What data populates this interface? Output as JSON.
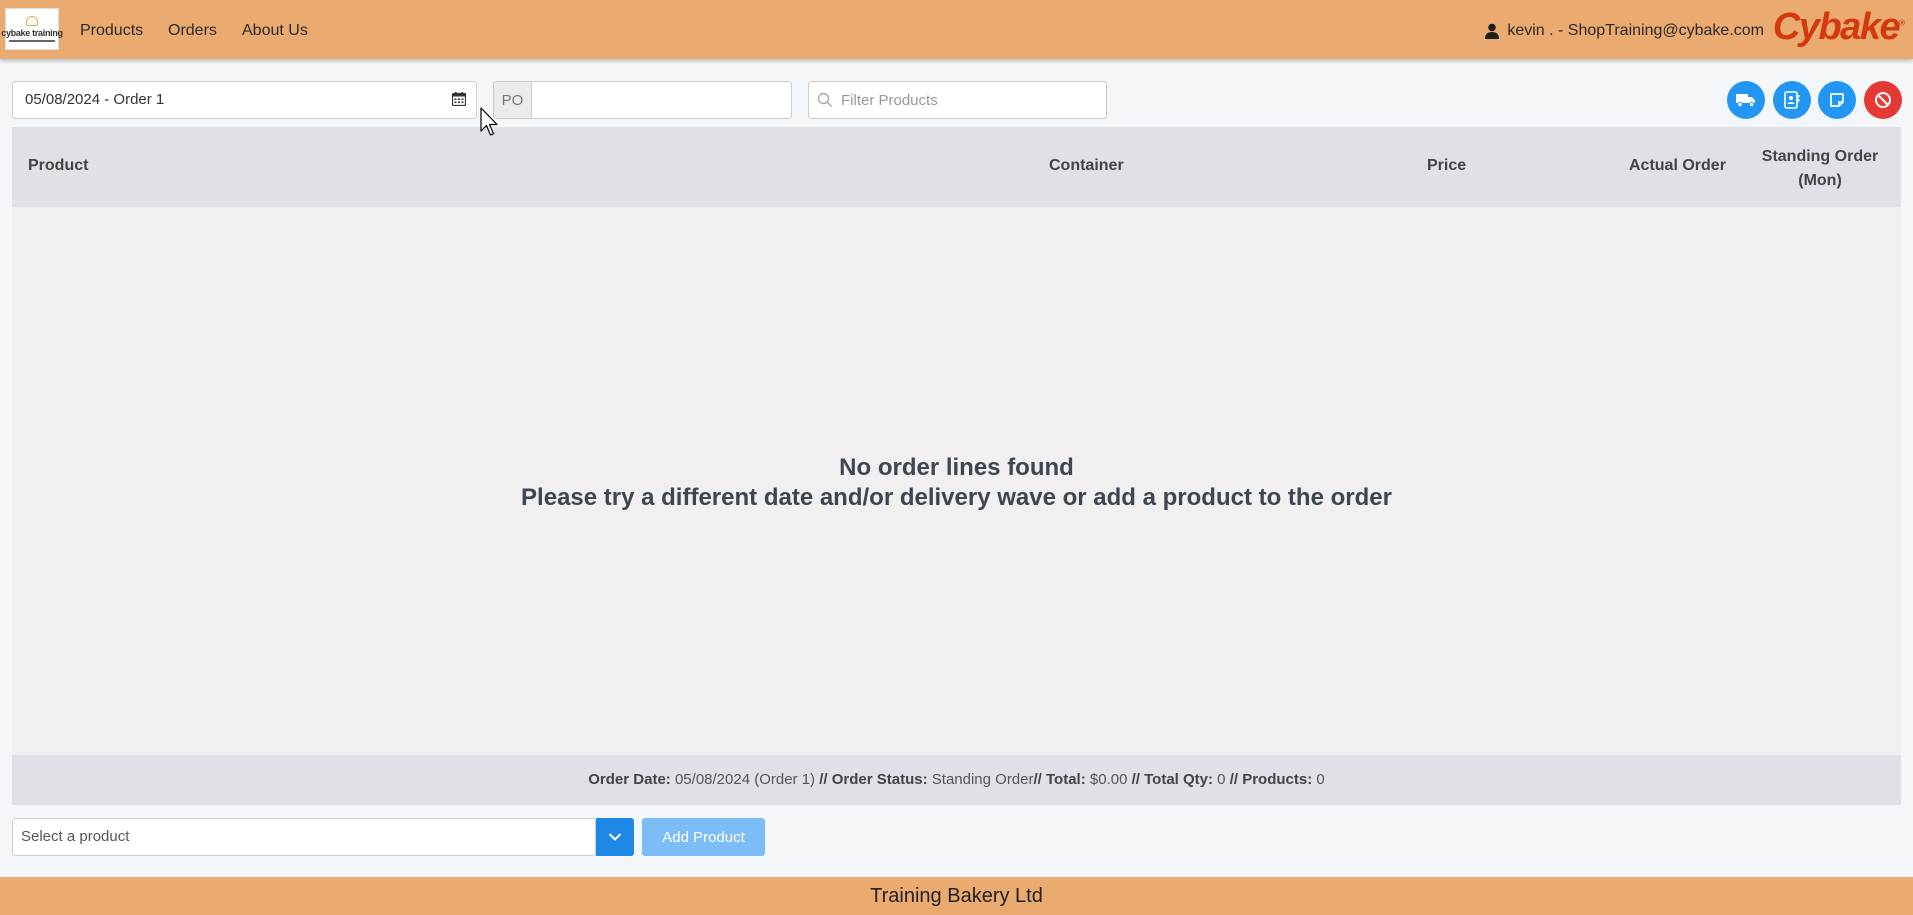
{
  "header": {
    "logo_text": "cybake training",
    "nav": [
      {
        "label": "Products"
      },
      {
        "label": "Orders"
      },
      {
        "label": "About Us"
      }
    ],
    "user_label": "kevin . - ShopTraining@cybake.com",
    "brand": "Cybake",
    "brand_mark": "®"
  },
  "toolbar": {
    "date_value": "05/08/2024 - Order 1",
    "po_label": "PO",
    "po_value": "",
    "filter_placeholder": "Filter Products",
    "actions": [
      {
        "icon": "truck-icon",
        "color": "#2196f3"
      },
      {
        "icon": "contact-card-icon",
        "color": "#2196f3"
      },
      {
        "icon": "note-icon",
        "color": "#2196f3"
      },
      {
        "icon": "cancel-icon",
        "color": "#e53935"
      }
    ]
  },
  "table": {
    "columns": {
      "product": "Product",
      "container": "Container",
      "price": "Price",
      "actual": "Actual Order",
      "standing_line1": "Standing Order",
      "standing_line2": "(Mon)"
    },
    "empty_line1": "No order lines found",
    "empty_line2": "Please try a different date and/or delivery wave or add a product to the order"
  },
  "summary": {
    "order_date_label": "Order Date:",
    "order_date_value": "05/08/2024 (Order 1)",
    "status_label": "// Order Status:",
    "status_value": "Standing Order",
    "total_label": "// Total:",
    "total_value": "$0.00",
    "qty_label": "// Total Qty:",
    "qty_value": "0",
    "products_label": "// Products:",
    "products_value": "0"
  },
  "add": {
    "select_placeholder": "Select a product",
    "button_label": "Add Product"
  },
  "footer": {
    "company": "Training Bakery Ltd"
  }
}
